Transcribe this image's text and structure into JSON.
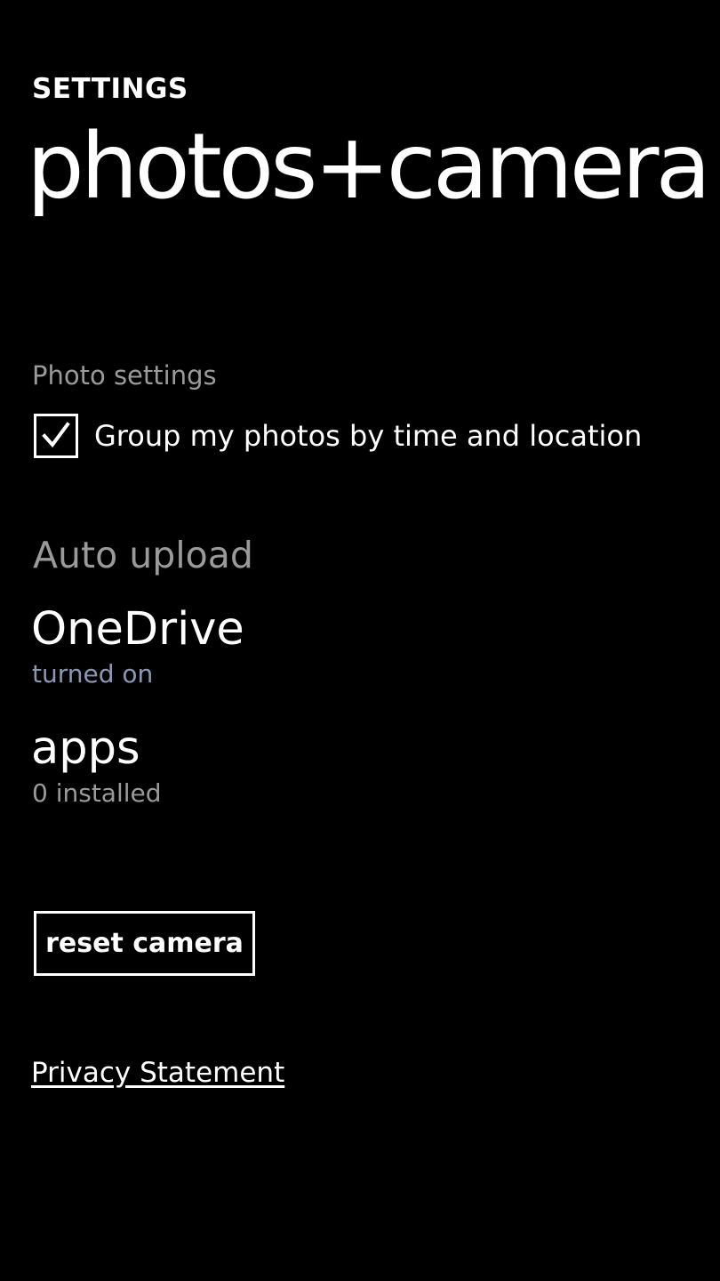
{
  "header": {
    "app_label": "SETTINGS",
    "page_title": "photos+camera"
  },
  "photo_settings": {
    "section_label": "Photo settings",
    "group_by_time_location": {
      "label": "Group my photos by time and location",
      "checked": true
    }
  },
  "auto_upload": {
    "header": "Auto upload",
    "items": [
      {
        "title": "OneDrive",
        "subtitle": "turned on"
      },
      {
        "title": "apps",
        "subtitle": "0 installed"
      }
    ]
  },
  "actions": {
    "reset_camera_label": "reset camera"
  },
  "links": {
    "privacy_label": "Privacy Statement"
  },
  "colors": {
    "background": "#000000",
    "foreground": "#ffffff",
    "secondary_text": "#9a9a9a",
    "accent_subtitle": "#8a98b4"
  },
  "icons": {
    "checkbox": "checkmark-icon"
  }
}
